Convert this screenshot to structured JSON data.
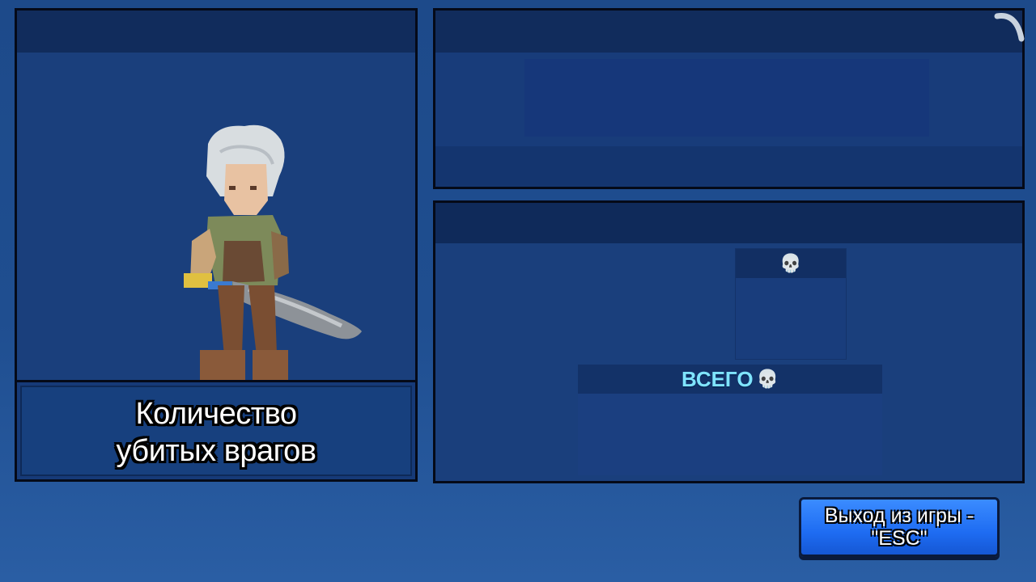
{
  "character_panel": {
    "title_line1": "Количество",
    "title_line2": "убитых врагов"
  },
  "score_panel": {
    "skull_icon": "skull-icon",
    "total_label": "ВСЕГО"
  },
  "exit_button": {
    "line1": "Выход из игры -",
    "line2": "\"ESC\""
  },
  "colors": {
    "background": "#1f4e90",
    "panel": "#1a3f7c",
    "panel_header": "#112c5c",
    "accent_text": "#7fe4ff",
    "button": "#2a7bff"
  }
}
